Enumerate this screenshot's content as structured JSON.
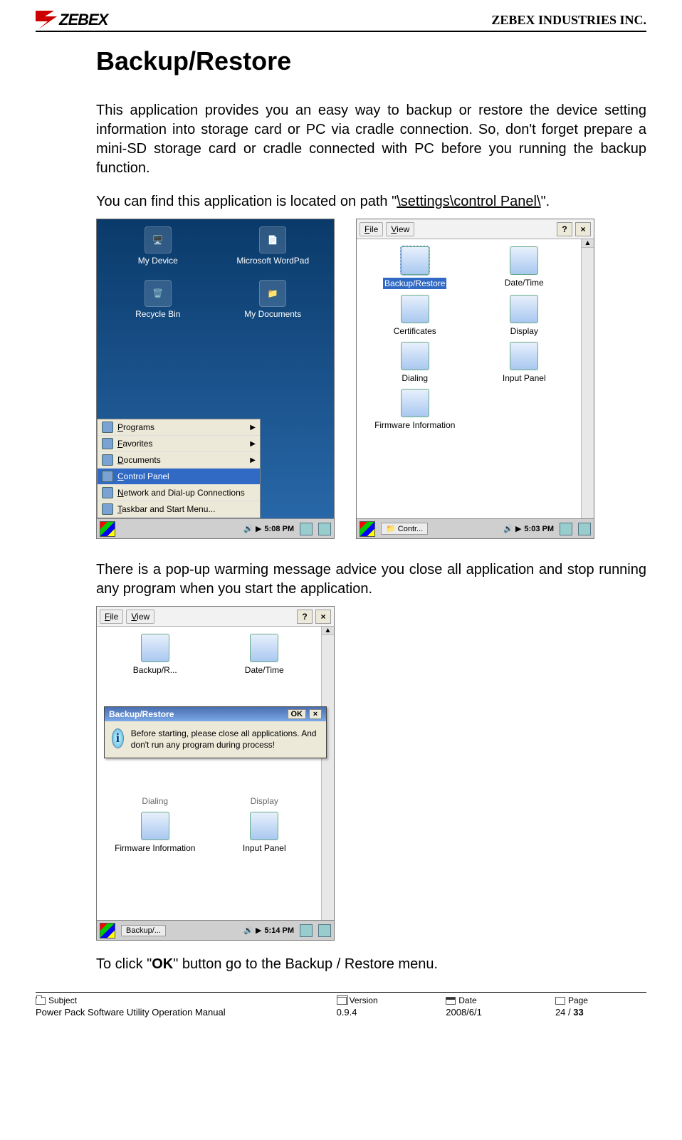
{
  "header": {
    "logo_text": "ZEBEX",
    "company": "ZEBEX INDUSTRIES INC."
  },
  "title": "Backup/Restore",
  "para1": "This application provides  you an easy way  to  backup  or  restore  the device setting information into storage card or PC via cradle connection.  So, don't forget prepare a mini-SD storage card or cradle connected with PC before you running the backup function.",
  "para2_pre": "You can find this application is located on path \"",
  "para2_path": "\\settings\\control Panel\\",
  "para2_post": "\".",
  "shot1": {
    "desktop": [
      {
        "label": "My Device"
      },
      {
        "label": "Microsoft WordPad"
      },
      {
        "label": "Recycle Bin"
      },
      {
        "label": "My Documents"
      }
    ],
    "menu": {
      "items": [
        {
          "label": "Programs",
          "sub": true,
          "u": "P"
        },
        {
          "label": "Favorites",
          "sub": true,
          "u": "F"
        },
        {
          "label": "Documents",
          "sub": true,
          "u": "D"
        },
        {
          "label": "Control Panel",
          "hilite": true,
          "u": "C"
        },
        {
          "label": "Network and Dial-up Connections",
          "u": "N"
        },
        {
          "label": "Taskbar and Start Menu...",
          "u": "T"
        }
      ]
    },
    "taskbar": {
      "time": "5:08 PM"
    }
  },
  "shot2": {
    "menubar": {
      "file": "File",
      "view": "View",
      "help": "?",
      "close": "×"
    },
    "icons": [
      {
        "label": "Backup/Restore",
        "selected": true
      },
      {
        "label": "Date/Time"
      },
      {
        "label": "Certificates"
      },
      {
        "label": "Display"
      },
      {
        "label": "Dialing"
      },
      {
        "label": "Input Panel"
      },
      {
        "label": "Firmware Information"
      }
    ],
    "taskbar": {
      "label": "Contr...",
      "time": "5:03 PM"
    }
  },
  "para3": "There is a pop-up warming message advice you close all application and stop running any program when you start the application.",
  "shot3": {
    "menubar": {
      "file": "File",
      "view": "View",
      "help": "?",
      "close": "×"
    },
    "bg_icons": [
      {
        "label": "Backup/R..."
      },
      {
        "label": "Date/Time"
      },
      {
        "label": "Dialing"
      },
      {
        "label": "Display"
      },
      {
        "label": "Firmware Information"
      },
      {
        "label": "Input Panel"
      }
    ],
    "dialog": {
      "title": "Backup/Restore",
      "ok": "OK",
      "close": "×",
      "message": "Before starting, please close all applications. And don't run any program during process!"
    },
    "taskbar": {
      "label": "Backup/...",
      "time": "5:14 PM"
    }
  },
  "para4_pre": "To click \"",
  "para4_ok": "OK",
  "para4_post": "\" button go to the Backup / Restore menu.",
  "footer": {
    "h1": "Subject",
    "h2": "Version",
    "h3": "Date",
    "h4": "Page",
    "v1": "Power Pack Software Utility Operation Manual",
    "v2": "0.9.4",
    "v3": "2008/6/1",
    "v4a": "24 / ",
    "v4b": "33"
  }
}
